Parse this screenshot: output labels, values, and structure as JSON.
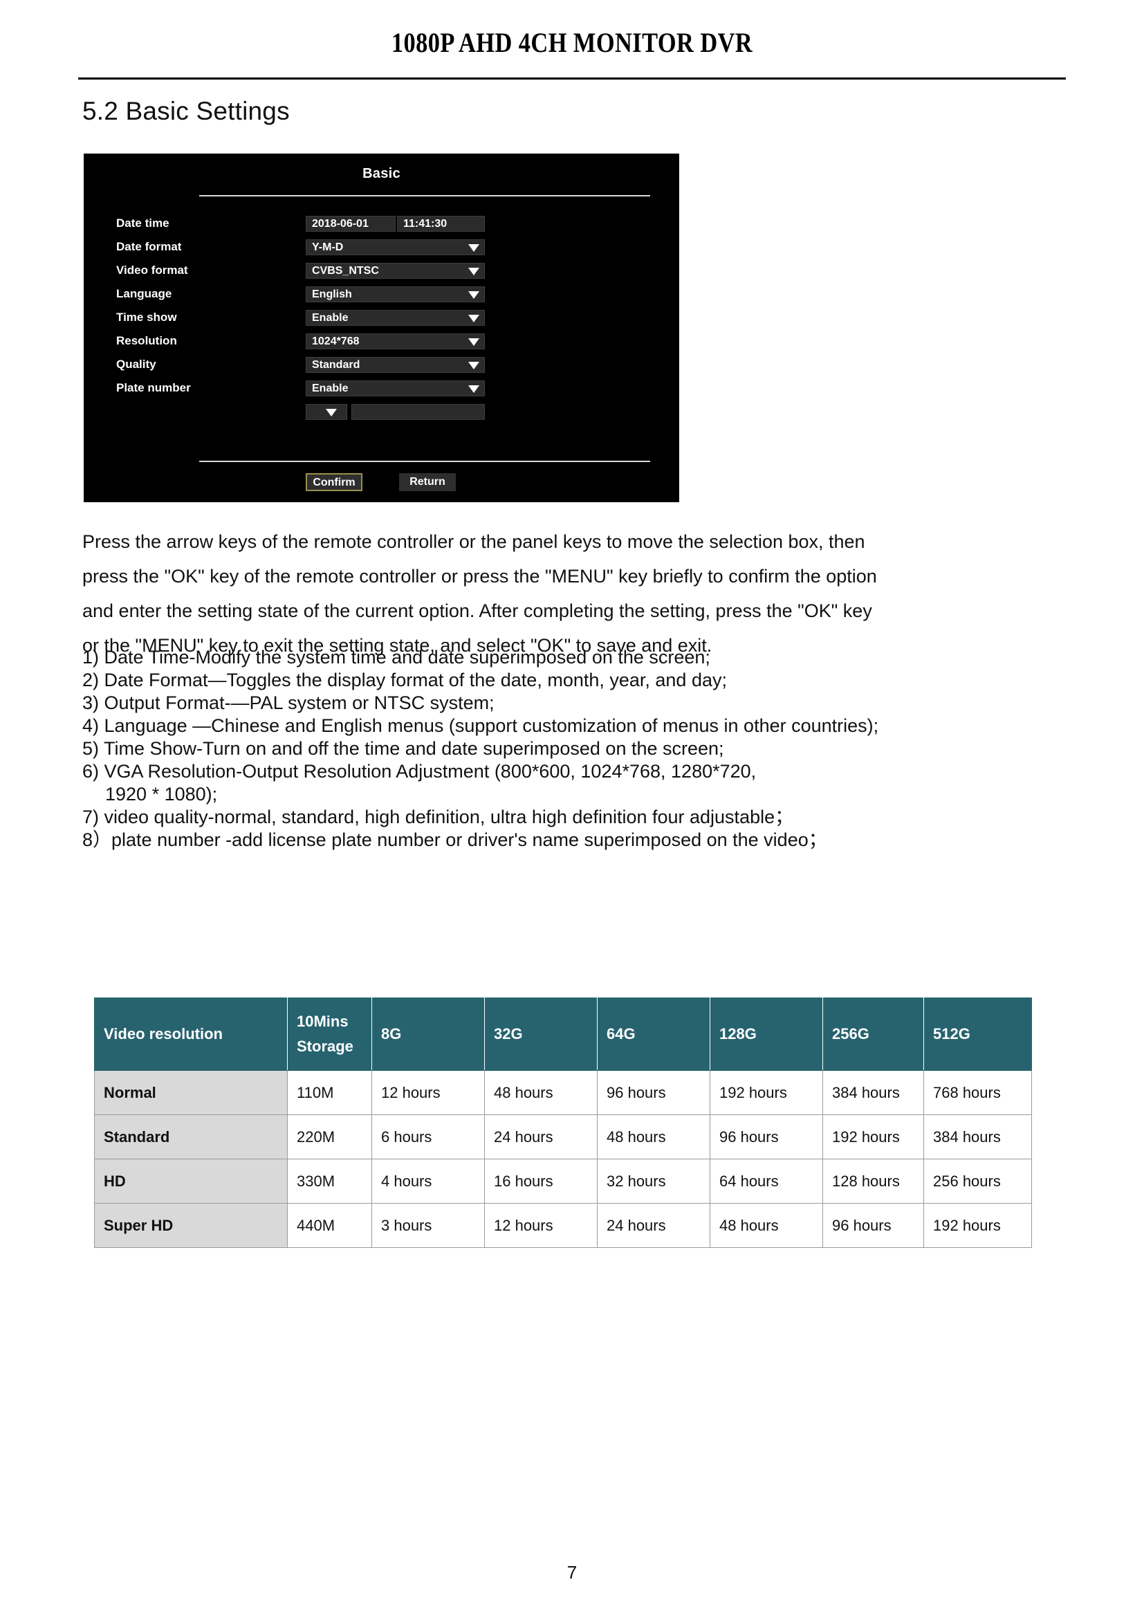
{
  "header": {
    "doc_title": "1080P AHD 4CH MONITOR DVR"
  },
  "section": {
    "heading": "5.2 Basic Settings"
  },
  "dvr_menu": {
    "title": "Basic",
    "rows": [
      {
        "label": "Date time",
        "type": "datetime",
        "date": "2018-06-01",
        "time": "11:41:30"
      },
      {
        "label": "Date format",
        "type": "select",
        "value": "Y-M-D"
      },
      {
        "label": "Video format",
        "type": "select",
        "value": "CVBS_NTSC"
      },
      {
        "label": "Language",
        "type": "select",
        "value": "English"
      },
      {
        "label": "Time show",
        "type": "select",
        "value": "Enable"
      },
      {
        "label": "Resolution",
        "type": "select",
        "value": "1024*768"
      },
      {
        "label": "Quality",
        "type": "select",
        "value": "Standard"
      },
      {
        "label": "Plate number",
        "type": "select",
        "value": "Enable"
      },
      {
        "label": "",
        "type": "mini",
        "value": ""
      }
    ],
    "buttons": {
      "confirm": "Confirm",
      "return": "Return"
    },
    "focus_color": "#9a8f4e"
  },
  "body": {
    "paragraph_lines": [
      "Press the arrow keys of the remote controller or the panel keys to move the selection box, then",
      "press the \"OK\" key of the remote controller or press the \"MENU\" key briefly to confirm the option",
      "and enter the setting state of the current option. After completing the setting, press the \"OK\" key",
      "or the \"MENU\" key to exit the setting state, and select \"OK\" to save and exit."
    ],
    "list_items": [
      "1) Date Time-Modify the system time and date superimposed on the screen;",
      "2) Date Format—Toggles the display format of the date, month, year, and day;",
      "3) Output Format-—PAL system or NTSC system;",
      "4) Language —Chinese and English menus (support customization of menus in other countries);",
      "5) Time Show-Turn on and off the time and date superimposed on the screen;",
      "6) VGA Resolution-Output Resolution Adjustment (800*600, 1024*768, 1280*720,",
      "7) video quality-normal, standard, high definition, ultra high definition four adjustable；",
      "8）plate number -add license plate number or driver's name superimposed on the video；"
    ],
    "list_item_6_continuation": "1920 * 1080);"
  },
  "storage_table": {
    "header_color": "#27636f",
    "rowhead_color": "#d9d9d9",
    "columns": [
      "Video resolution",
      "10Mins\nStorage",
      "8G",
      "32G",
      "64G",
      "128G",
      "256G",
      "512G"
    ],
    "column_header_line1": "10Mins",
    "column_header_line2": "Storage",
    "rows": [
      {
        "resolution": "Normal",
        "storage": "110M",
        "c8g": "12 hours",
        "c32g": "48 hours",
        "c64g": "96 hours",
        "c128g": "192 hours",
        "c256g": "384 hours",
        "c512g": "768 hours"
      },
      {
        "resolution": "Standard",
        "storage": "220M",
        "c8g": "6 hours",
        "c32g": "24 hours",
        "c64g": "48 hours",
        "c128g": "96 hours",
        "c256g": "192 hours",
        "c512g": "384 hours"
      },
      {
        "resolution": "HD",
        "storage": "330M",
        "c8g": "4 hours",
        "c32g": "16 hours",
        "c64g": "32 hours",
        "c128g": "64 hours",
        "c256g": "128 hours",
        "c512g": "256 hours"
      },
      {
        "resolution": "Super HD",
        "storage": "440M",
        "c8g": "3 hours",
        "c32g": "12 hours",
        "c64g": "24 hours",
        "c128g": "48 hours",
        "c256g": "96 hours",
        "c512g": "192 hours"
      }
    ]
  },
  "footer": {
    "page_number": "7"
  }
}
